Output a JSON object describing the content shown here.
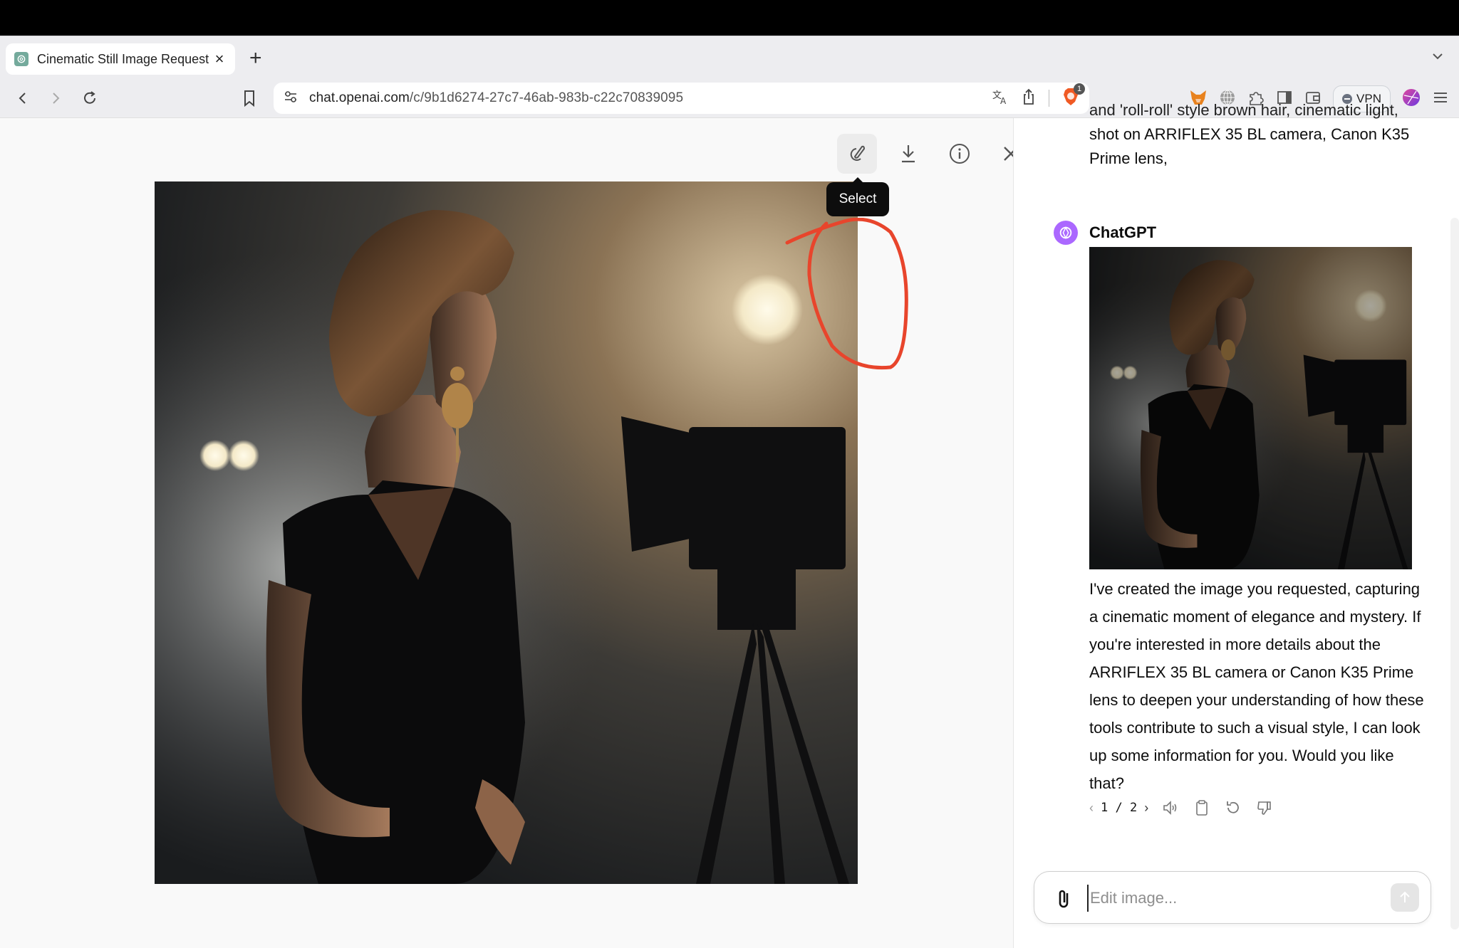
{
  "browser": {
    "tab": {
      "title": "Cinematic Still Image Request",
      "close_label": "×"
    },
    "new_tab_label": "+",
    "url_host": "chat.openai.com",
    "url_path": "/c/9b1d6274-27c7-46ab-983b-c22c70839095",
    "brave_badge_count": "1",
    "vpn_label": "VPN"
  },
  "viewer": {
    "toolbar": {
      "select_tooltip": "Select",
      "buttons": [
        "select",
        "download",
        "info",
        "close"
      ]
    },
    "annotation_color": "#e8452c"
  },
  "chat": {
    "user_message_cut_line": "and 'roll-roll' style brown hair, cinematic light,",
    "user_message_lines": [
      "shot on ARRIFLEX 35 BL camera, Canon K35",
      "Prime lens,"
    ],
    "assistant_name": "ChatGPT",
    "assistant_avatar_color": "#ab68ff",
    "reply": "I've created the image you requested, capturing a cinematic moment of elegance and mystery. If you're interested in more details about the ARRIFLEX 35 BL camera or Canon K35 Prime lens to deepen your understanding of how these tools contribute to such a visual style, I can look up some information for you. Would you like that?",
    "pager": {
      "current": "1",
      "total": "2",
      "text": "1 / 2"
    },
    "composer": {
      "placeholder": "Edit image...",
      "value": ""
    }
  }
}
